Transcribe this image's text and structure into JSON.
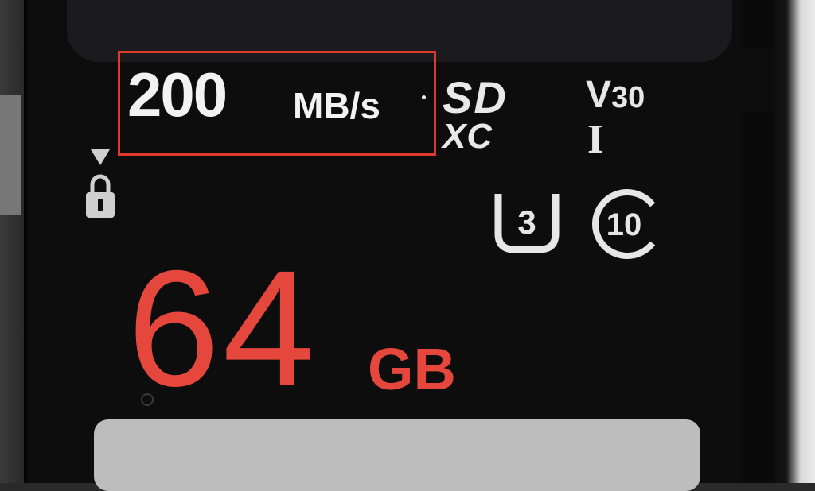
{
  "card": {
    "speed": {
      "number": "200",
      "unit": "MB/s"
    },
    "sd_logo": {
      "top": "SD",
      "bottom": "XC"
    },
    "video_class": {
      "letter": "V",
      "number": "30"
    },
    "uhs_bus": "I",
    "uhs_speed_class": "3",
    "speed_class": "10",
    "capacity": {
      "number": "64",
      "unit": "GB"
    }
  },
  "colors": {
    "highlight_box": "#e03a2e",
    "capacity_text": "#e5473c",
    "card_body": "#0d0d0d",
    "logo_text": "#e9e9e9"
  }
}
